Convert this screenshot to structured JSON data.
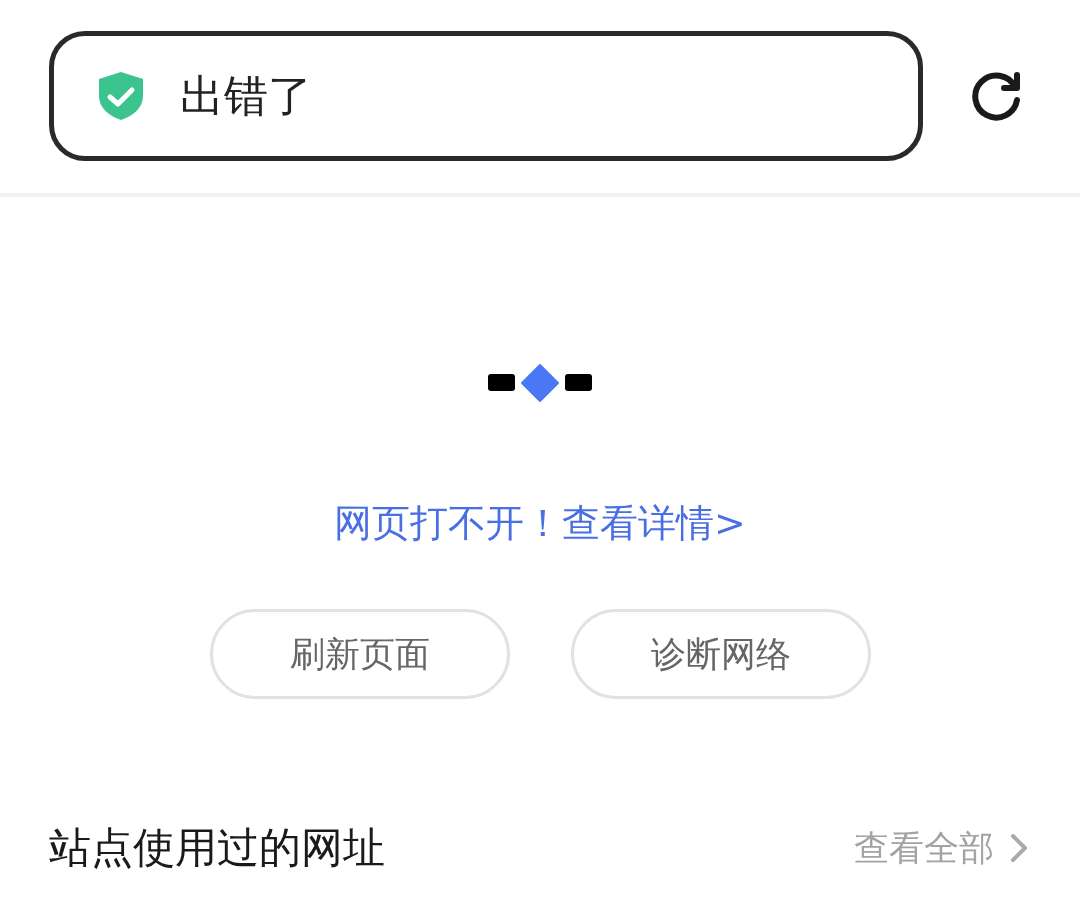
{
  "address_bar": {
    "secure": true,
    "title": "出错了"
  },
  "error": {
    "message": "网页打不开！",
    "details_link": "查看详情>"
  },
  "actions": [
    "刷新页面",
    "诊断网络"
  ],
  "history_section": {
    "title": "站点使用过的网址",
    "view_all": "查看全部"
  }
}
